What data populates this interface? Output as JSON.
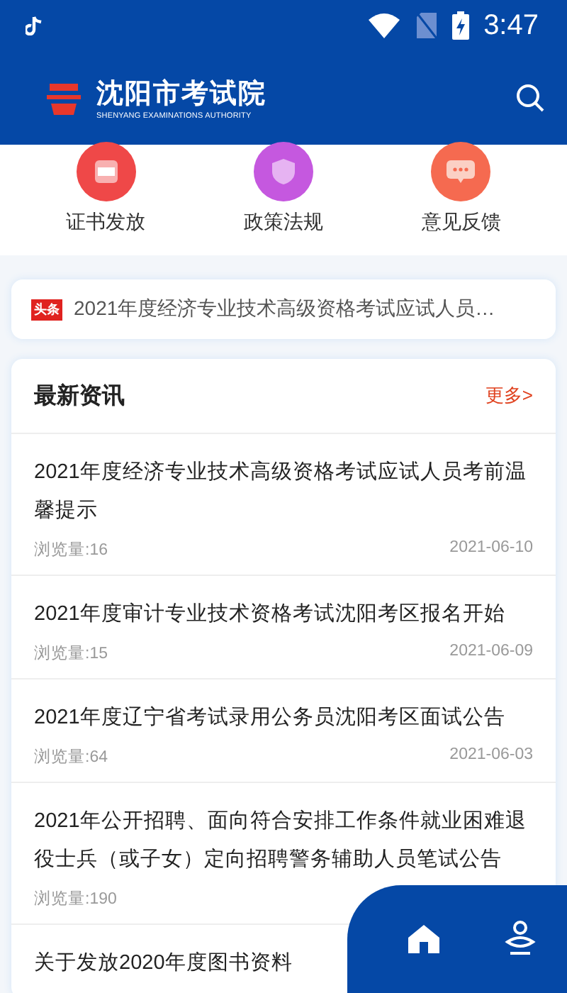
{
  "status_bar": {
    "time": "3:47"
  },
  "header": {
    "title": "沈阳市考试院",
    "subtitle": "SHENYANG EXAMINATIONS AUTHORITY"
  },
  "shortcuts": [
    {
      "label": "证书发放",
      "kind": "certificate",
      "color": "#ef4848"
    },
    {
      "label": "政策法规",
      "kind": "law",
      "color": "#c558df"
    },
    {
      "label": "意见反馈",
      "kind": "feedback",
      "color": "#f56a50"
    }
  ],
  "headline": {
    "badge": "头条",
    "text": "2021年度经济专业技术高级资格考试应试人员…"
  },
  "news": {
    "title": "最新资讯",
    "more": "更多>",
    "items": [
      {
        "title": "2021年度经济专业技术高级资格考试应试人员考前温馨提示",
        "views": "浏览量:16",
        "date": "2021-06-10"
      },
      {
        "title": "2021年度审计专业技术资格考试沈阳考区报名开始",
        "views": "浏览量:15",
        "date": "2021-06-09"
      },
      {
        "title": "2021年度辽宁省考试录用公务员沈阳考区面试公告",
        "views": "浏览量:64",
        "date": "2021-06-03"
      },
      {
        "title": "2021年公开招聘、面向符合安排工作条件就业困难退役士兵（或子女）定向招聘警务辅助人员笔试公告",
        "views": "浏览量:190"
      },
      {
        "title": "关于发放2020年度图书资料"
      }
    ]
  }
}
